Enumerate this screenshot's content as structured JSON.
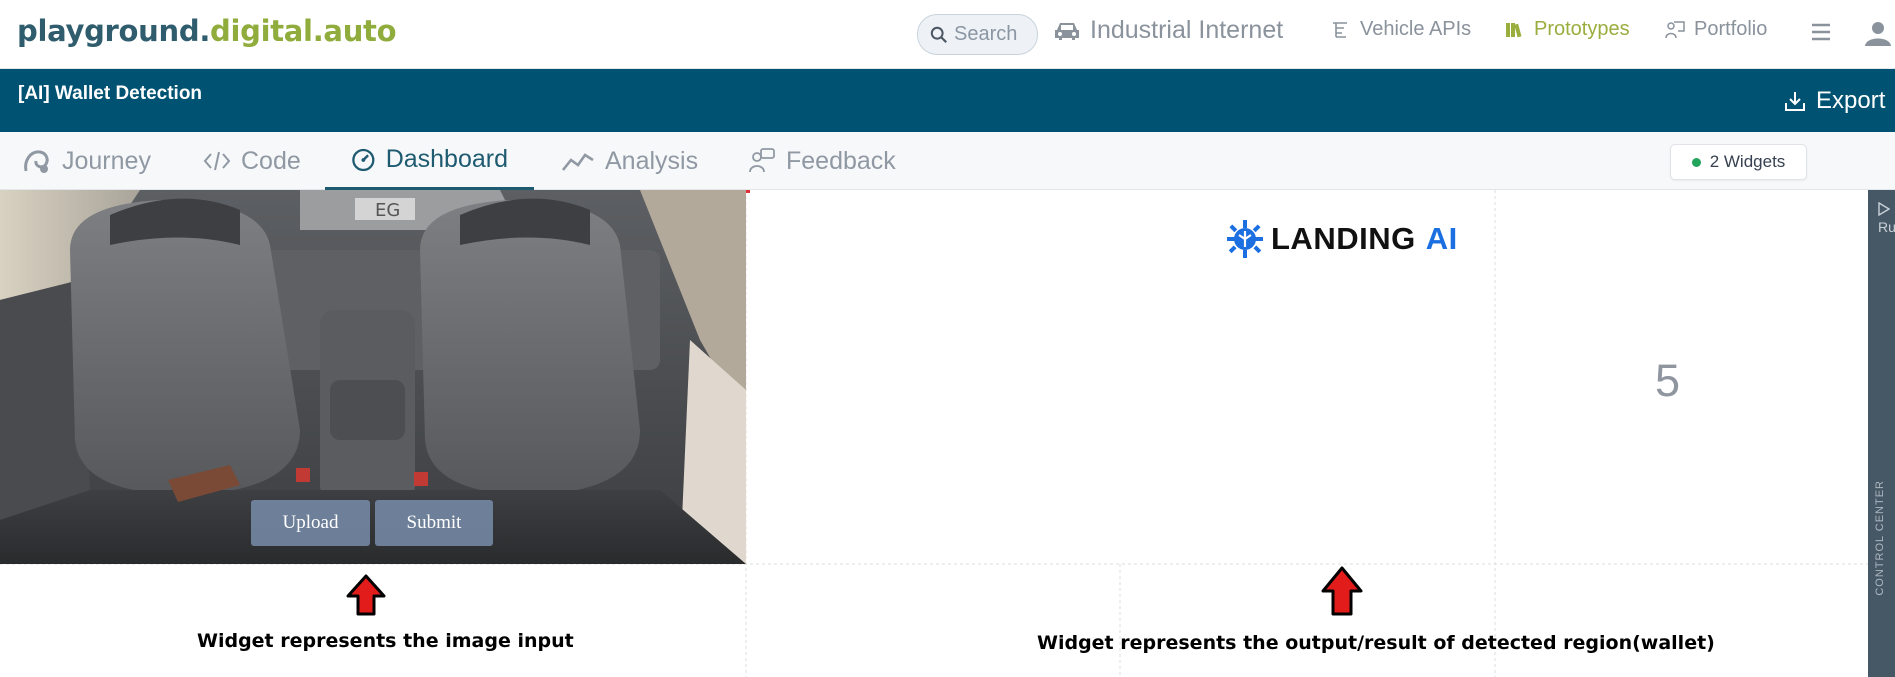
{
  "topnav": {
    "logo_part1": "playground.",
    "logo_part2": "digital.auto",
    "search_placeholder": "Search",
    "industrial": "Industrial Internet",
    "vehicle_apis": "Vehicle APIs",
    "prototypes": "Prototypes",
    "portfolio": "Portfolio"
  },
  "titlebar": {
    "title": "[AI] Wallet Detection",
    "export": "Export"
  },
  "tabs": [
    {
      "label": "Journey"
    },
    {
      "label": "Code"
    },
    {
      "label": "Dashboard"
    },
    {
      "label": "Analysis"
    },
    {
      "label": "Feedback"
    }
  ],
  "active_tab": "Dashboard",
  "widgets_badge": "2 Widgets",
  "image_widget": {
    "upload_label": "Upload",
    "submit_label": "Submit"
  },
  "result_widget": {
    "brand_word": "LANDING",
    "brand_ai": "AI",
    "value": "5"
  },
  "control_center": {
    "run_label": "Ru",
    "label": "CONTROL CENTER"
  },
  "annotations": {
    "caption_left": "Widget represents the image input",
    "caption_right": "Widget represents the output/result of detected region(wallet)"
  },
  "colors": {
    "title_bar": "#005272",
    "accent_green": "#9aae3e",
    "active_tab": "#1e5a70",
    "landing_blue": "#1b6fe0"
  }
}
